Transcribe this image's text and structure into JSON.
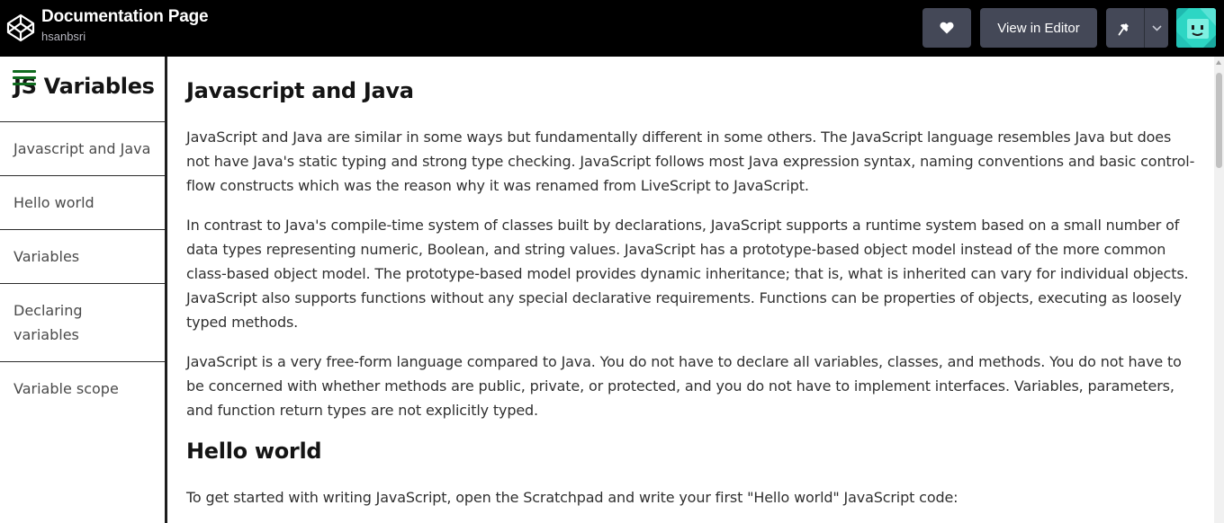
{
  "topbar": {
    "title": "Documentation Page",
    "author": "hsanbsri",
    "editor_label": "View in Editor",
    "icons": [
      "codepen-logo-icon",
      "heart-icon",
      "pin-icon",
      "chevron-down-icon",
      "avatar"
    ]
  },
  "sidebar": {
    "title": "JS Variables",
    "items": [
      {
        "label": "Javascript and Java"
      },
      {
        "label": "Hello world"
      },
      {
        "label": "Variables"
      },
      {
        "label": "Declaring variables"
      },
      {
        "label": "Variable scope"
      }
    ],
    "accent_color": "#0f6b1f"
  },
  "main": {
    "sections": [
      {
        "title": "Javascript and Java",
        "paragraphs": [
          "JavaScript and Java are similar in some ways but fundamentally different in some others. The JavaScript language resembles Java but does not have Java's static typing and strong type checking. JavaScript follows most Java expression syntax, naming conventions and basic control-flow constructs which was the reason why it was renamed from LiveScript to JavaScript.",
          "In contrast to Java's compile-time system of classes built by declarations, JavaScript supports a runtime system based on a small number of data types representing numeric, Boolean, and string values. JavaScript has a prototype-based object model instead of the more common class-based object model. The prototype-based model provides dynamic inheritance; that is, what is inherited can vary for individual objects. JavaScript also supports functions without any special declarative requirements. Functions can be properties of objects, executing as loosely typed methods.",
          "JavaScript is a very free-form language compared to Java. You do not have to declare all variables, classes, and methods. You do not have to be concerned with whether methods are public, private, or protected, and you do not have to implement interfaces. Variables, parameters, and function return types are not explicitly typed."
        ]
      },
      {
        "title": "Hello world",
        "paragraphs": [
          "To get started with writing JavaScript, open the Scratchpad and write your first \"Hello world\" JavaScript code:"
        ]
      }
    ]
  },
  "colors": {
    "topbar_bg": "#000000",
    "button_bg": "#444857",
    "sidebar_border": "#1e1e1e"
  }
}
